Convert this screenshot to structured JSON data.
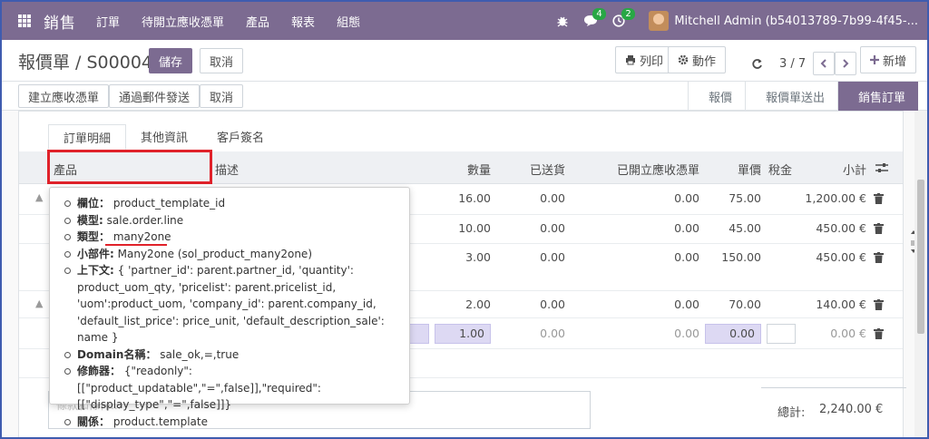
{
  "navbar": {
    "brand": "銷售",
    "menu": [
      "訂單",
      "待開立應收憑單",
      "產品",
      "報表",
      "組態"
    ],
    "messages_count": "4",
    "activities_count": "2",
    "user": "Mitchell Admin (b54013789-7b99-4f45-..."
  },
  "control_panel": {
    "breadcrumb_parent": "報價單",
    "breadcrumb_sep": " / ",
    "breadcrumb_current": "S00004",
    "save_label": "儲存",
    "discard_label": "取消",
    "print_label": "列印",
    "action_label": "動作",
    "pager": "3 / 7",
    "new_label": "新增"
  },
  "statusbar": {
    "create_invoice": "建立應收憑單",
    "send_email": "通過郵件發送",
    "cancel": "取消",
    "stages": [
      "報價",
      "報價單送出",
      "銷售訂單"
    ],
    "active_stage": "銷售訂單"
  },
  "tabs": [
    "訂單明細",
    "其他資訊",
    "客戶簽名"
  ],
  "columns": {
    "product": "產品",
    "description": "描述",
    "quantity": "數量",
    "delivered": "已送貨",
    "invoiced": "已開立應收憑單",
    "unit_price": "單價",
    "taxes": "稅金",
    "subtotal": "小計"
  },
  "rows": [
    {
      "quantity": "16.00",
      "delivered": "0.00",
      "invoiced": "0.00",
      "unit_price": "75.00",
      "subtotal": "1,200.00 €"
    },
    {
      "quantity": "10.00",
      "delivered": "0.00",
      "invoiced": "0.00",
      "unit_price": "45.00",
      "subtotal": "450.00 €"
    },
    {
      "quantity": "3.00",
      "delivered": "0.00",
      "invoiced": "0.00",
      "unit_price": "150.00",
      "subtotal": "450.00 €"
    },
    {
      "quantity": "2.00",
      "delivered": "0.00",
      "invoiced": "0.00",
      "unit_price": "70.00",
      "subtotal": "140.00 €"
    },
    {
      "quantity": "1.00",
      "delivered": "0.00",
      "invoiced": "0.00",
      "unit_price": "0.00",
      "subtotal": "0.00 €"
    }
  ],
  "notes_placeholder": "條款和條件...",
  "total_label": "總計:",
  "total_value": "2,240.00 €",
  "tooltip": {
    "field_label": "欄位：",
    "field_value": "product_template_id",
    "model_label": "模型:",
    "model_value": "sale.order.line",
    "type_label": "類型：",
    "type_value": "many2one",
    "widget_label": "小部件:",
    "widget_value": "Many2one (sol_product_many2one)",
    "context_label": "上下文:",
    "context_value": "{ 'partner_id': parent.partner_id, 'quantity': product_uom_qty, 'pricelist': parent.pricelist_id, 'uom':product_uom, 'company_id': parent.company_id, 'default_list_price': price_unit, 'default_description_sale': name }",
    "domain_label": "Domain名稱：",
    "domain_value": "sale_ok,=,true",
    "modifiers_label": "修飾器：",
    "modifiers_value": "{\"readonly\":[[\"product_updatable\",\"=\",false]],\"required\":[[\"display_type\",\"=\",false]]}",
    "relation_label": "關係：",
    "relation_value": "product.template"
  },
  "colors": {
    "primary": "#7c6b91",
    "highlight_red": "#e0222a",
    "badge_green": "#28a745",
    "input_bg": "#ddd9f3"
  },
  "icons": [
    "apps-icon",
    "bug-icon",
    "chat-icon",
    "clock-icon",
    "print-icon",
    "gear-icon",
    "refresh-icon",
    "chevron-left-icon",
    "chevron-right-icon",
    "plus-icon",
    "drag-handle-icon",
    "trash-icon",
    "column-settings-icon"
  ]
}
